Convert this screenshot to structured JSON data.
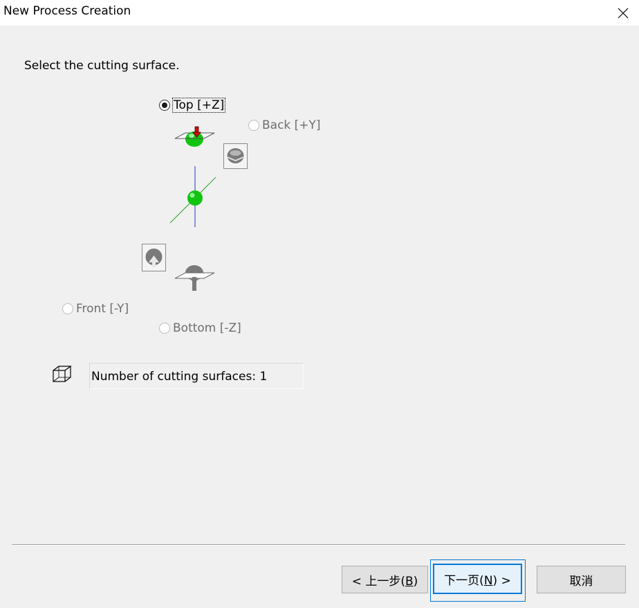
{
  "window": {
    "title": "New Process Creation",
    "close_icon": "close-icon"
  },
  "instruction": "Select the cutting surface.",
  "surfaces": {
    "top": {
      "label": "Top [+Z]",
      "selected": true,
      "enabled": true
    },
    "back": {
      "label": "Back [+Y]",
      "selected": false,
      "enabled": false
    },
    "front": {
      "label": "Front [-Y]",
      "selected": false,
      "enabled": false
    },
    "bottom": {
      "label": "Bottom [-Z]",
      "selected": false,
      "enabled": false
    }
  },
  "count_field": {
    "text": "Number of cutting surfaces: 1",
    "icon": "cube-icon"
  },
  "buttons": {
    "back_prefix": "< 上一步(",
    "back_key": "B",
    "back_suffix": ")",
    "next_prefix": "下一页(",
    "next_key": "N",
    "next_suffix": ") >",
    "cancel": "取消"
  },
  "colors": {
    "accent": "#0078d7",
    "sphere_green": "#11c411",
    "arrow_red": "#d01010",
    "axis_blue": "#2233cc",
    "axis_green": "#2ea02e"
  }
}
